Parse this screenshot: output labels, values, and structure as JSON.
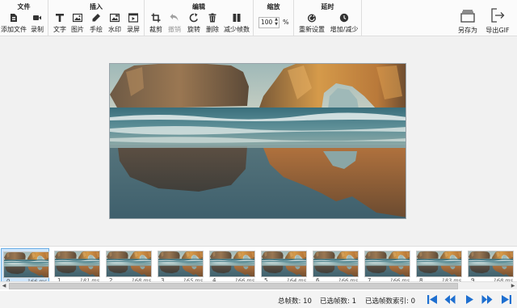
{
  "ribbon": {
    "file": {
      "title": "文件",
      "add_file": "添加文件",
      "record": "录制"
    },
    "insert": {
      "title": "插入",
      "text": "文字",
      "image": "图片",
      "draw": "手绘",
      "watermark": "水印",
      "screen": "录屏"
    },
    "edit": {
      "title": "编辑",
      "crop": "裁剪",
      "undo": "撤销",
      "rotate": "旋转",
      "delete": "删除",
      "reduce_frames": "减少帧数"
    },
    "zoom": {
      "title": "缩放",
      "value": "100",
      "unit": "%"
    },
    "delay": {
      "title": "延时",
      "reset": "重新设置",
      "add_reduce": "增加/减少"
    },
    "save_as": "另存为",
    "export_gif": "导出GIF"
  },
  "frames": [
    {
      "num": "0",
      "ms": "166 ms"
    },
    {
      "num": "1",
      "ms": "181 ms"
    },
    {
      "num": "2",
      "ms": "168 ms"
    },
    {
      "num": "3",
      "ms": "165 ms"
    },
    {
      "num": "4",
      "ms": "166 ms"
    },
    {
      "num": "5",
      "ms": "164 ms"
    },
    {
      "num": "6",
      "ms": "166 ms"
    },
    {
      "num": "7",
      "ms": "166 ms"
    },
    {
      "num": "8",
      "ms": "183 ms"
    },
    {
      "num": "9",
      "ms": "168 ms"
    }
  ],
  "status": {
    "total_frames": "总帧数: 10",
    "selected_frames": "已选帧数: 1",
    "selected_index": "已选帧数索引: 0"
  },
  "colors": {
    "accent": "#1e6fd0",
    "selection": "#cfe6fb"
  },
  "icons": [
    "file-add-icon",
    "record-icon",
    "text-icon",
    "image-icon",
    "pencil-icon",
    "watermark-icon",
    "screen-record-icon",
    "crop-icon",
    "undo-icon",
    "rotate-icon",
    "trash-icon",
    "reduce-frames-icon",
    "reset-icon",
    "clock-icon",
    "save-as-icon",
    "export-icon",
    "first-frame-icon",
    "prev-frame-icon",
    "play-icon",
    "next-frame-icon",
    "last-frame-icon"
  ]
}
